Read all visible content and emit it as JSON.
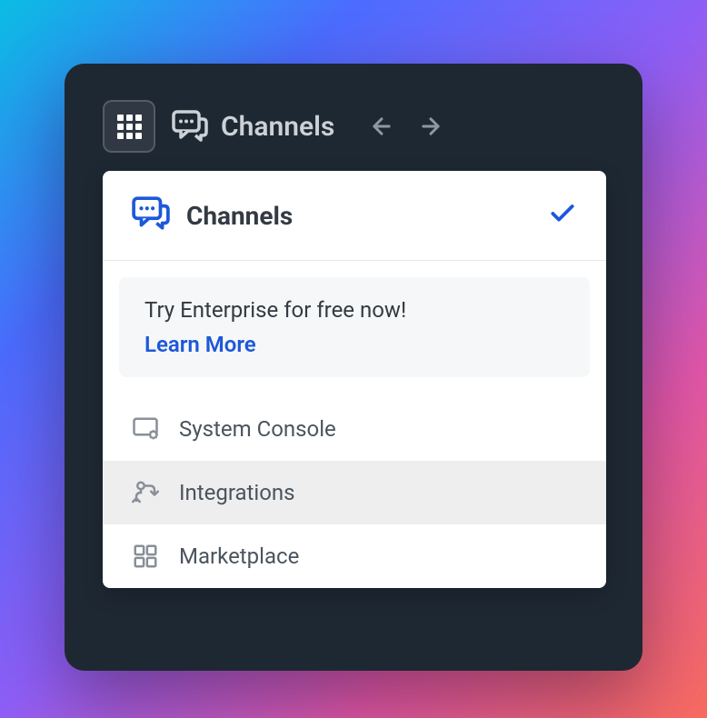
{
  "header": {
    "title": "Channels"
  },
  "dropdown": {
    "selected": {
      "label": "Channels"
    },
    "promo": {
      "title": "Try Enterprise for free now!",
      "link": "Learn More"
    },
    "items": [
      {
        "label": "System Console",
        "icon": "system-console-icon"
      },
      {
        "label": "Integrations",
        "icon": "integrations-icon"
      },
      {
        "label": "Marketplace",
        "icon": "marketplace-icon"
      }
    ]
  }
}
